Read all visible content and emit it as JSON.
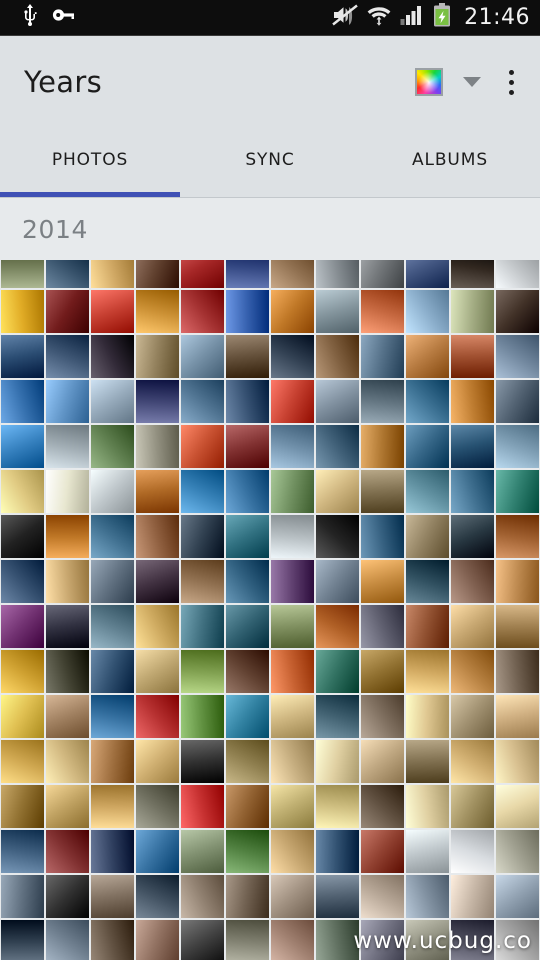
{
  "status_bar": {
    "background": "#0d0d0d",
    "time": "21:46",
    "left_icons": [
      "usb-icon",
      "vpn-key-icon"
    ],
    "right_icons": [
      "volume-mute-icon",
      "wifi-icon",
      "cellular-signal-icon",
      "battery-charging-icon"
    ],
    "battery_color": "#7ac043"
  },
  "action_bar": {
    "title": "Years",
    "background": "#dde1e4",
    "color_swatch_label": "color-filter-swatch",
    "dropdown_label": "dropdown-caret",
    "overflow_label": "More options"
  },
  "tabs": {
    "active_index": 0,
    "indicator_color": "#3f51b5",
    "items": [
      {
        "label": "PHOTOS"
      },
      {
        "label": "SYNC"
      },
      {
        "label": "ALBUMS"
      }
    ]
  },
  "section": {
    "year": "2014"
  },
  "watermark": {
    "text": "www.ucbug.co"
  },
  "grid": {
    "columns": 12,
    "cell_size": 45,
    "thumbnails": [
      "#6f7a55",
      "#2f4a63",
      "#c9a15d",
      "#5a3a28",
      "#9e1f1f",
      "#2b3f7a",
      "#8a6a4a",
      "#7e858a",
      "#6b6f72",
      "#3b4f7a",
      "#2a2018",
      "#b9bdc0",
      "#d9a41e",
      "#6a1414",
      "#c0392b",
      "#c58a2e",
      "#9e2b2b",
      "#2f5aa8",
      "#b8701f",
      "#7d8e96",
      "#c0623a",
      "#84a7c4",
      "#9ea77e",
      "#3a2a20",
      "#23456b",
      "#38506e",
      "#2a2230",
      "#8c7a56",
      "#6f8aa0",
      "#5e4a34",
      "#2b3a4c",
      "#7a5a3a",
      "#4e6a82",
      "#b0743a",
      "#9a4a2a",
      "#6c8299",
      "#2f6aa8",
      "#5a8ec0",
      "#8fa3b4",
      "#3a3f6e",
      "#4a6e8c",
      "#2f4a6b",
      "#c03a2a",
      "#7a8a99",
      "#5c6e7a",
      "#356a8c",
      "#b8762a",
      "#4a5a6a",
      "#2f7ab8",
      "#9aa6ad",
      "#5a7a4a",
      "#8c8a7a",
      "#c14a2a",
      "#7a2a2a",
      "#6a8aa4",
      "#3a5a72",
      "#a8702a",
      "#2e5f80",
      "#1f4a6a",
      "#7a9ab0",
      "#d8c27a",
      "#e0dfc8",
      "#b8c0c4",
      "#a8621e",
      "#2f7ab0",
      "#2f6a9a",
      "#6a8a5a",
      "#c9b07a",
      "#7a6a4a",
      "#5a8a9a",
      "#3a6a8a",
      "#2a7a6a",
      "#1a1a1a",
      "#b8701f",
      "#3a6a8a",
      "#8a5a3a",
      "#2a3a4a",
      "#2a6a7a",
      "#b0b8bc",
      "#1c1c1c",
      "#2f5a7a",
      "#8a7a5a",
      "#20303a",
      "#9a5a2a",
      "#2f4a6a",
      "#c3a26a",
      "#5a6a7a",
      "#3a2a3a",
      "#8a6a4a",
      "#2a5a7a",
      "#5a3a6a",
      "#6a7a8a",
      "#c0853a",
      "#2a4a5a",
      "#7a5a4a",
      "#b8844a",
      "#6a2a6a",
      "#2a2a3a",
      "#5a7a8a",
      "#c8a45a",
      "#3a6a7a",
      "#2a5a6a",
      "#7a8a5a",
      "#a8581e",
      "#5a5a6a",
      "#8a4a2a",
      "#c0a06a",
      "#9a7a4a",
      "#c89a2a",
      "#3a3a2a",
      "#2a4a6a",
      "#b8a06a",
      "#7a9a4a",
      "#5a3a2a",
      "#c05a2a",
      "#2a6a5a",
      "#8a6a2a",
      "#caa25a",
      "#b07a3a",
      "#6a5a4a",
      "#d8b84a",
      "#9a7a5a",
      "#2f6a9a",
      "#b02a2a",
      "#5a8a3a",
      "#2a7a9a",
      "#c8b07a",
      "#3a5a6a",
      "#7a6a5a",
      "#d8c08a",
      "#9a8a6a",
      "#c8a87a",
      "#c9a14a",
      "#cbb27a",
      "#9a6a3a",
      "#c8a86a",
      "#2a2a2a",
      "#8a7a4a",
      "#c0a87a",
      "#d8c89a",
      "#b8a07a",
      "#7a6a4a",
      "#caa86a",
      "#d0b888",
      "#8a6a2a",
      "#b89a5a",
      "#c8a05a",
      "#6a6a5a",
      "#c02a2a",
      "#8a5a2a",
      "#b8a86a",
      "#c8b87a",
      "#5a4a3a",
      "#d8c89a",
      "#9a8a5a",
      "#e0d0a0",
      "#3a5a7a",
      "#7a2a2a",
      "#2a3a5a",
      "#2f6a9a",
      "#7a8a6a",
      "#4a7a3a",
      "#c0a06a",
      "#2a4a6a",
      "#8a3a2a",
      "#b8c0c4",
      "#d0d4d8",
      "#9a9a8a",
      "#5a6a7a",
      "#2a2a2a",
      "#7a6a5a",
      "#3a4a5a",
      "#8a7a6a",
      "#6a5a4a",
      "#9a8a7a",
      "#4a5a6a",
      "#b0a090",
      "#7a8a9a",
      "#c0b0a0",
      "#8a9aaa",
      "#2a3a4a",
      "#6a7a8a",
      "#5a4a3a",
      "#8a6a5a",
      "#3a3a3a",
      "#7a7a6a",
      "#9a7a6a",
      "#5a6a5a",
      "#6a6a7a",
      "#8a8a7a",
      "#4a4a5a",
      "#a0a0a0"
    ]
  }
}
